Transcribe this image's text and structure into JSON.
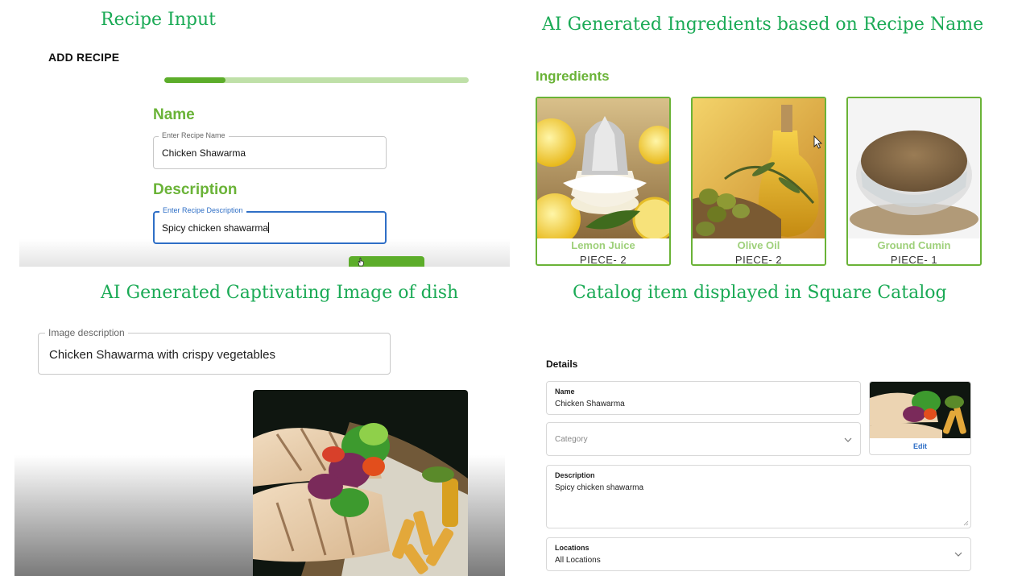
{
  "captions": {
    "recipe_input": "Recipe Input",
    "ai_ingredients": "AI Generated Ingredients based on Recipe Name",
    "ai_image": "AI Generated Captivating Image of dish",
    "catalog": "Catalog item displayed in Square Catalog"
  },
  "recipe_form": {
    "title": "ADD RECIPE",
    "progress_fraction": 0.2,
    "name_section": "Name",
    "name_field_label": "Enter Recipe Name",
    "name_value": "Chicken Shawarma",
    "description_section": "Description",
    "description_field_label": "Enter Recipe Description",
    "description_value": "Spicy chicken shawarma"
  },
  "ingredients": {
    "title": "Ingredients",
    "items": [
      {
        "name": "Lemon Juice",
        "quantity": "PIECE- 2",
        "icon": "lemon-juicer-image"
      },
      {
        "name": "Olive Oil",
        "quantity": "PIECE- 2",
        "icon": "olive-oil-image"
      },
      {
        "name": "Ground Cumin",
        "quantity": "PIECE- 1",
        "icon": "cumin-bowl-image"
      }
    ]
  },
  "image_generation": {
    "field_label": "Image description",
    "field_value": "Chicken Shawarma with crispy vegetables"
  },
  "catalog": {
    "section_title": "Details",
    "name_label": "Name",
    "name_value": "Chicken Shawarma",
    "category_placeholder": "Category",
    "image_edit": "Edit",
    "description_label": "Description",
    "description_value": "Spicy chicken shawarma",
    "locations_label": "Locations",
    "locations_value": "All Locations"
  },
  "colors": {
    "caption_green": "#1aaa55",
    "brand_green": "#6ab337",
    "progress_fill": "#5cad2a",
    "progress_track": "#bfe0a8",
    "focus_blue": "#2f6fc6"
  }
}
